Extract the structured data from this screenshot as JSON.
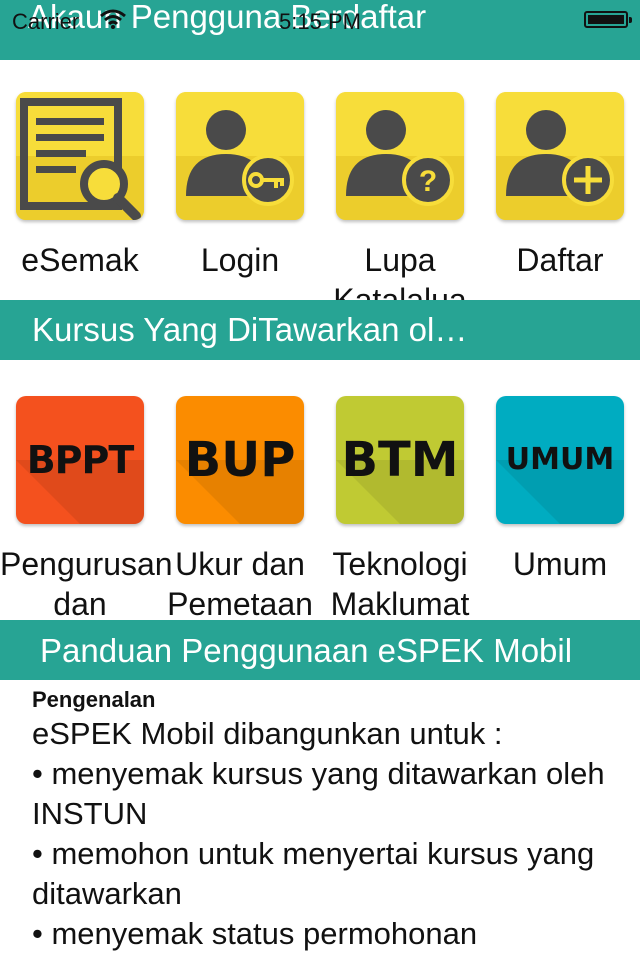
{
  "status_bar": {
    "carrier": "Carrier",
    "time": "5:15 PM"
  },
  "registered_section": {
    "title": "Akaun Pengguna Berdaftar",
    "items": [
      {
        "label": "eSemak",
        "icon": "document-search-icon"
      },
      {
        "label": "Login",
        "icon": "user-key-icon"
      },
      {
        "label": "Lupa Katalalua",
        "icon": "user-question-icon"
      },
      {
        "label": "Daftar",
        "icon": "user-add-icon"
      }
    ]
  },
  "courses_section": {
    "title": "Kursus Yang DiTawarkan ol…",
    "items": [
      {
        "code": "BPPT",
        "label": "Pengurusan dan",
        "color": "#f4511e"
      },
      {
        "code": "BUP",
        "label": "Ukur dan Pemetaan",
        "color": "#fb8c00"
      },
      {
        "code": "BTM",
        "label": "Teknologi Maklumat",
        "color": "#c0ca33"
      },
      {
        "code": "UMUM",
        "label": "Umum",
        "color": "#00acc1"
      }
    ]
  },
  "guide_section": {
    "title": "Panduan Penggunaan eSPEK Mobil",
    "heading": "Pengenalan",
    "body": "eSPEK Mobil dibangunkan untuk :\n• menyemak kursus yang ditawarkan oleh INSTUN\n• memohon untuk menyertai kursus yang ditawarkan\n• menyemak status permohonan"
  },
  "colors": {
    "header_bg": "#27a494",
    "tile_yellow": "#f7dd3a",
    "icon_dark": "#4a4a4a"
  }
}
